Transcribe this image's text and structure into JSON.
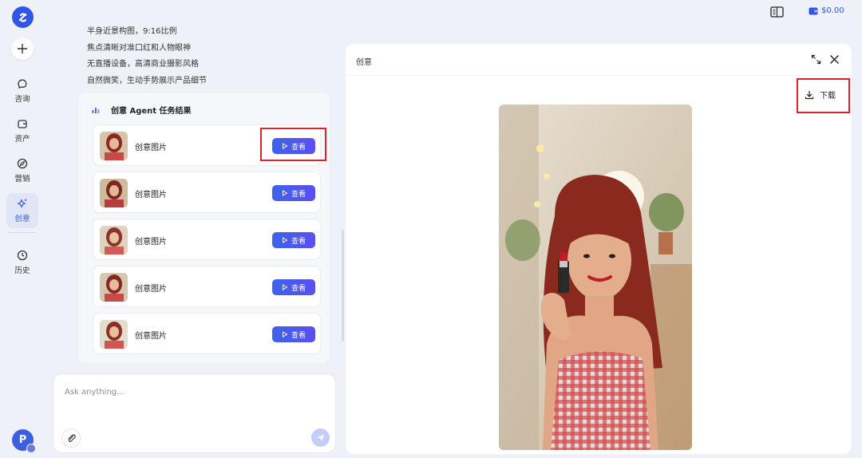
{
  "sidebar": {
    "new_label": "+",
    "items": [
      {
        "label": "咨询",
        "icon": "chat-icon"
      },
      {
        "label": "资产",
        "icon": "wallet-icon"
      },
      {
        "label": "营销",
        "icon": "compass-icon"
      },
      {
        "label": "创意",
        "icon": "sparkle-icon"
      },
      {
        "label": "历史",
        "icon": "clock-icon"
      }
    ],
    "active": "创意",
    "avatar_letter": "P"
  },
  "topbar": {
    "balance": "$0.00"
  },
  "chat": {
    "lines": [
      "半身近景构图，9:16比例",
      "焦点清晰对准口红和人物眼神",
      "无直播设备，高清商业摄影风格",
      "自然微笑，生动手势展示产品细节"
    ],
    "result_title": "创意 Agent 任务结果",
    "results": [
      {
        "name": "创意图片",
        "button": "查看"
      },
      {
        "name": "创意图片",
        "button": "查看"
      },
      {
        "name": "创意图片",
        "button": "查看"
      },
      {
        "name": "创意图片",
        "button": "查看"
      },
      {
        "name": "创意图片",
        "button": "查看"
      }
    ]
  },
  "composer": {
    "placeholder": "Ask anything..."
  },
  "panel": {
    "title": "创意",
    "download_label": "下载"
  },
  "colors": {
    "accent": "#2f56e8",
    "highlight": "#d9242a",
    "background": "#eef1f7"
  }
}
